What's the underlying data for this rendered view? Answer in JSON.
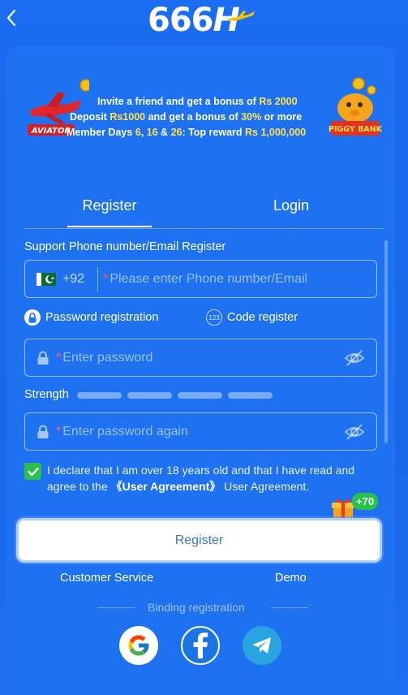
{
  "header": {
    "logo_number": "666",
    "logo_letter": "H"
  },
  "banner": {
    "line1_prefix": "Invite a friend and get a bonus of ",
    "line1_amount": "Rs 2000",
    "line2_prefix": "Deposit ",
    "line2_amount": "Rs1000",
    "line2_mid": " and get a bonus of ",
    "line2_percent": "30%",
    "line2_suffix": " or more",
    "line3_prefix": "Member Days ",
    "line3_day1": "6",
    "line3_sep1": ", ",
    "line3_day2": "16",
    "line3_sep2": " & ",
    "line3_day3": "26",
    "line3_mid": ": Top reward ",
    "line3_amount": "Rs 1,000,000",
    "left_game": "AVIATOR",
    "right_game": "PIGGY BANK"
  },
  "tabs": [
    {
      "label": "Register",
      "active": true
    },
    {
      "label": "Login",
      "active": false
    }
  ],
  "form": {
    "section_label": "Support Phone number/Email Register",
    "country_code": "+92",
    "phone_placeholder": "Please enter Phone number/Email",
    "mode_password": "Password registration",
    "mode_code": "Code register",
    "code_icon_text": "123",
    "password_placeholder": "Enter password",
    "strength_label": "Strength",
    "password_again_placeholder": "Enter password again",
    "required_mark": "*",
    "agreement_prefix": "I declare that I am over 18 years old and that I have read and agree to the ",
    "agreement_link": "《User Agreement》",
    "agreement_suffix": " User Agreement.",
    "gift_badge": "+70",
    "register_button": "Register"
  },
  "footer": {
    "customer_service": "Customer Service",
    "demo": "Demo",
    "binding_label": "Binding registration"
  },
  "colors": {
    "background": "#1a6cf0",
    "card": "#1e72f2",
    "highlight": "#ffe14a",
    "check_green": "#2ac04a",
    "required_red": "#ff5a5a"
  }
}
